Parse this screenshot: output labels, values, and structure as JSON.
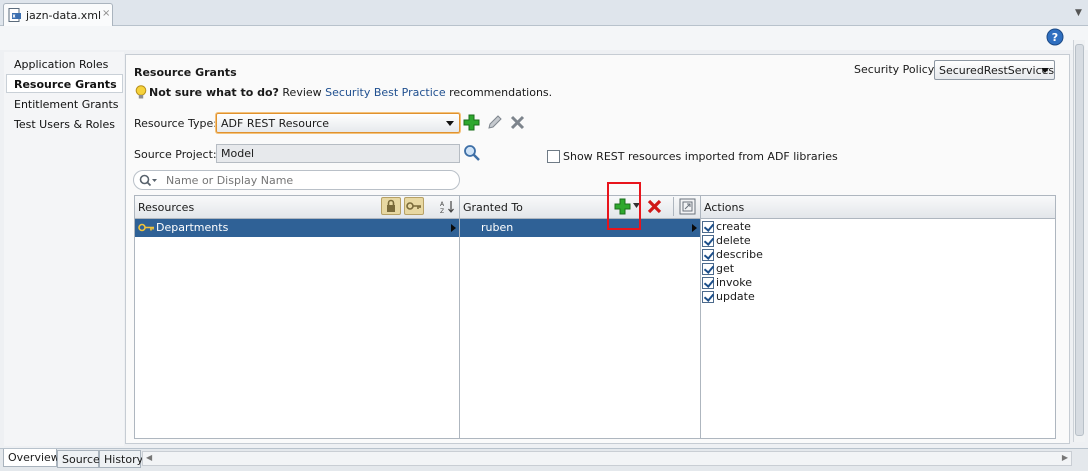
{
  "document_tab": {
    "title": "jazn-data.xml",
    "close": "×"
  },
  "left_nav": {
    "items": [
      {
        "label": "Application Roles"
      },
      {
        "label": "Resource Grants"
      },
      {
        "label": "Entitlement Grants"
      },
      {
        "label": "Test Users & Roles"
      }
    ],
    "selected": "Resource Grants"
  },
  "main": {
    "title": "Resource Grants",
    "hint_bold": "Not sure what to do?",
    "hint_prefix": "Review",
    "hint_link": "Security Best Practice",
    "hint_suffix": "recommendations.",
    "security_policy_label": "Security Policy:",
    "security_policy_value": "SecuredRestServices",
    "resource_type_label": "Resource Type:",
    "resource_type_value": "ADF REST Resource",
    "source_project_label": "Source Project:",
    "source_project_value": "Model",
    "show_rest_label": "Show REST resources imported from ADF libraries",
    "search_placeholder": "Name or Display Name"
  },
  "grid": {
    "resources_header": "Resources",
    "granted_to_header": "Granted To",
    "actions_header": "Actions",
    "resources": [
      "Departments"
    ],
    "granted_to": [
      "ruben"
    ],
    "actions": [
      {
        "label": "create",
        "checked": true
      },
      {
        "label": "delete",
        "checked": true
      },
      {
        "label": "describe",
        "checked": true
      },
      {
        "label": "get",
        "checked": true
      },
      {
        "label": "invoke",
        "checked": true
      },
      {
        "label": "update",
        "checked": true
      }
    ]
  },
  "bottom_tabs": [
    "Overview",
    "Source",
    "History"
  ],
  "colors": {
    "selection": "#2f6196",
    "link": "#1f4f8f",
    "highlight_box": "#e8141c",
    "add_green": "#2ea82e",
    "delete_red": "#d01818"
  }
}
